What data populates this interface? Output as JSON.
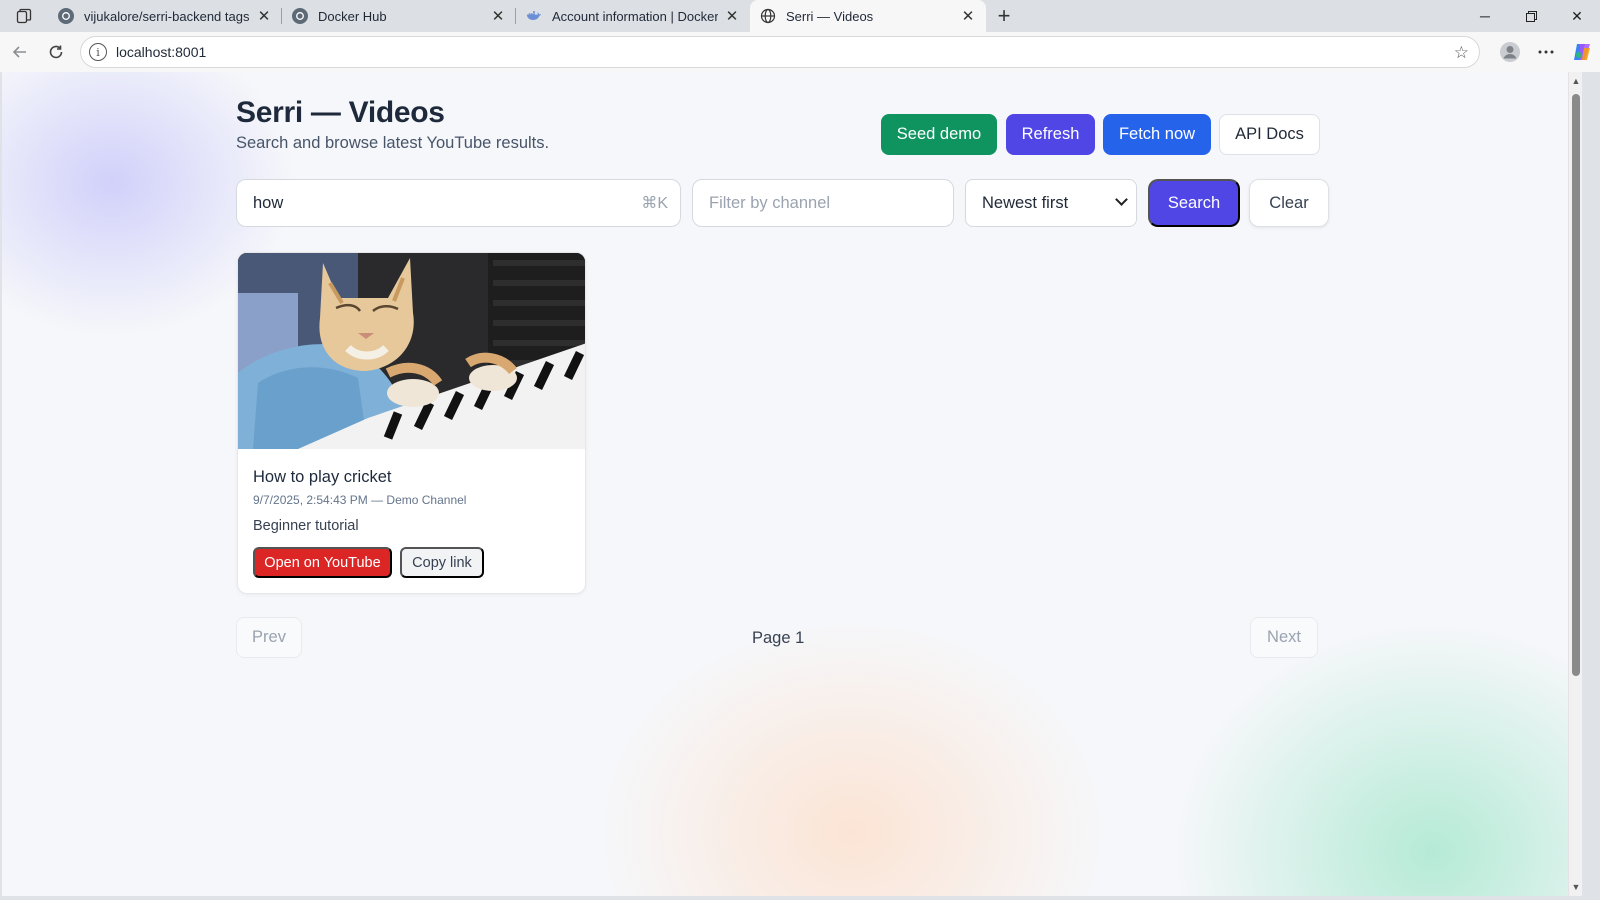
{
  "browser": {
    "tabs": [
      {
        "title": "vijukalore/serri-backend tags | Do",
        "icon": "docker-favicon-icon",
        "active": false
      },
      {
        "title": "Docker Hub",
        "icon": "docker-favicon-icon",
        "active": false
      },
      {
        "title": "Account information | Docker",
        "icon": "docker-whale-icon",
        "active": false
      },
      {
        "title": "Serri — Videos",
        "icon": "globe-icon",
        "active": true
      }
    ],
    "url": "localhost:8001"
  },
  "page": {
    "title": "Serri — Videos",
    "subtitle": "Search and browse latest YouTube results.",
    "actions": {
      "seed": "Seed demo",
      "refresh": "Refresh",
      "fetch": "Fetch now",
      "api_docs": "API Docs"
    },
    "filters": {
      "query": "how",
      "shortcut": "⌘K",
      "channel_placeholder": "Filter by channel",
      "sort": "Newest first",
      "search": "Search",
      "clear": "Clear"
    },
    "videos": [
      {
        "title": "How to play cricket",
        "meta": "9/7/2025, 2:54:43 PM — Demo Channel",
        "description": "Beginner tutorial",
        "open_label": "Open on YouTube",
        "copy_label": "Copy link"
      }
    ],
    "pagination": {
      "prev": "Prev",
      "page_label": "Page 1",
      "next": "Next"
    }
  },
  "colors": {
    "seed": "#0f9460",
    "refresh": "#4f46e5",
    "fetch": "#2563eb",
    "search": "#4f46e5",
    "youtube": "#dc2626"
  }
}
